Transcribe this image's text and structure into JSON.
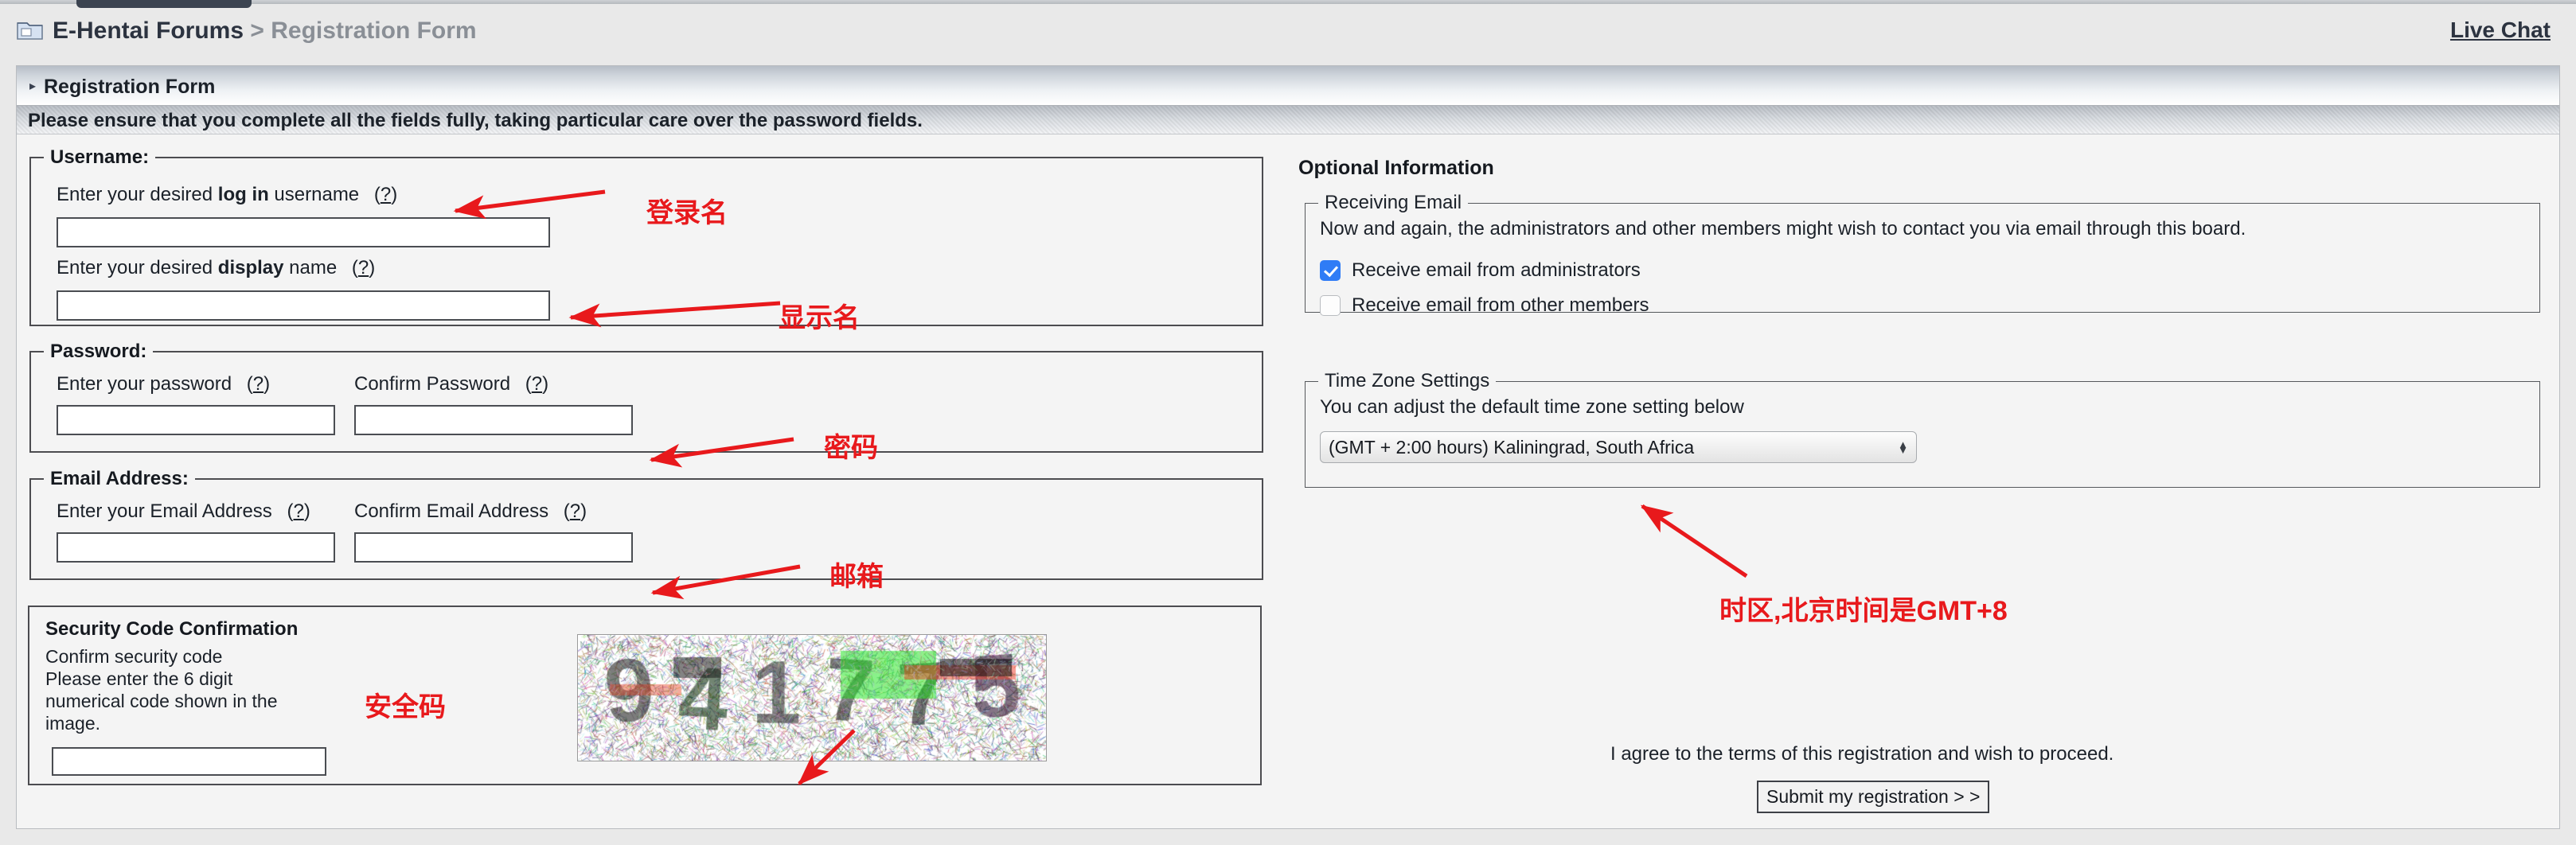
{
  "header": {
    "folder_icon": "folder-icon",
    "site": "E-Hentai Forums",
    "separator": ">",
    "page": "Registration Form",
    "live_chat": "Live Chat"
  },
  "panel": {
    "title": "Registration Form",
    "collapse_arrow": "▸",
    "notice": "Please ensure that you complete all the fields fully, taking particular care over the password fields."
  },
  "username_section": {
    "legend": "Username:",
    "login_label_pre": "Enter your desired ",
    "login_label_bold": "log in",
    "login_label_post": " username",
    "login_help": "(?)",
    "login_value": "",
    "display_label_pre": "Enter your desired ",
    "display_label_bold": "display",
    "display_label_post": " name",
    "display_help": "(?)",
    "display_value": ""
  },
  "password_section": {
    "legend": "Password:",
    "password_label": "Enter your password",
    "password_help": "(?)",
    "password_value": "",
    "confirm_label": "Confirm Password",
    "confirm_help": "(?)",
    "confirm_value": ""
  },
  "email_section": {
    "legend": "Email Address:",
    "email_label": "Enter your Email Address",
    "email_help": "(?)",
    "email_value": "",
    "confirm_label": "Confirm Email Address",
    "confirm_help": "(?)",
    "confirm_value": ""
  },
  "security_section": {
    "title": "Security Code Confirmation",
    "line1": "Confirm security code",
    "line2": "Please enter the 6 digit numerical code shown in the image.",
    "input_value": "",
    "captcha_alt": "captcha-image",
    "captcha_digits": "941775"
  },
  "optional_section": {
    "title": "Optional Information",
    "receiving_email": {
      "legend": "Receiving Email",
      "description": "Now and again, the administrators and other members might wish to contact you via email through this board.",
      "options": [
        {
          "label": "Receive email from administrators",
          "checked": true
        },
        {
          "label": "Receive email from other members",
          "checked": false
        }
      ]
    },
    "timezone": {
      "legend": "Time Zone Settings",
      "description": "You can adjust the default time zone setting below",
      "selected": "(GMT + 2:00 hours) Kaliningrad, South Africa",
      "stepper_up": "▲",
      "stepper_down": "▼"
    },
    "agree_text": "I agree to the terms of this registration and wish to proceed.",
    "submit_label": "Submit my registration > >"
  },
  "annotations": {
    "accent_color": "#e8191c",
    "items": [
      {
        "text": "登录名",
        "name": "annotation-login-name"
      },
      {
        "text": "显示名",
        "name": "annotation-display-name"
      },
      {
        "text": "密码",
        "name": "annotation-password"
      },
      {
        "text": "邮箱",
        "name": "annotation-email"
      },
      {
        "text": "安全码",
        "name": "annotation-security-code"
      },
      {
        "text": "时区,北京时间是GMT+8",
        "name": "annotation-timezone"
      }
    ]
  }
}
